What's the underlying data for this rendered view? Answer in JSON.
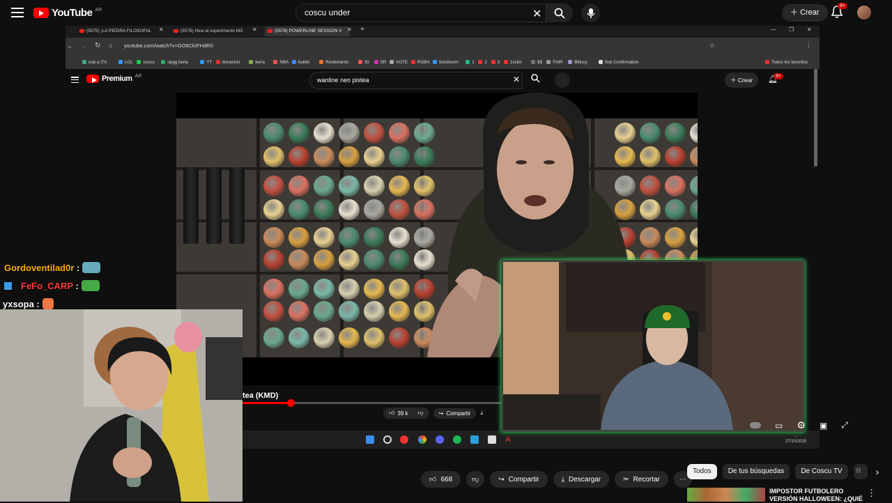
{
  "outer": {
    "logo": "YouTube",
    "country": "AR",
    "search_value": "coscu under",
    "create_label": "Crear",
    "notif_badge": "9+"
  },
  "browser": {
    "tabs": [
      {
        "label": "(5575) ¡LA PIEDRA FILOSOFAL"
      },
      {
        "label": "(5578) Hice el experimento MÁ"
      },
      {
        "label": "(5578) POWERLINE SESSION V"
      }
    ],
    "url": "youtube.com/watch?v=GO6CkIFHdR0",
    "bookmarks": [
      "esp a ITA",
      "LOL",
      "coscu",
      "opgg keria",
      "YT",
      "donacion",
      "keria",
      "NBA",
      "builds",
      "Roobetardo",
      "IG",
      "SR",
      "VOTE",
      "ROBA",
      "Soloboom",
      "1",
      "2",
      "3",
      "1xslot",
      "$$",
      "FAIR",
      "Bitlucy",
      "Sub Confirmation",
      "Todos los favoritos"
    ]
  },
  "inner": {
    "logo": "Premium",
    "country": "AR",
    "search_value": "wanline neo pistea",
    "create_label": "Crear",
    "notif_badge": "9+",
    "video_title": "tea (KMD)",
    "likes": "39 k",
    "share_label": "Compartir",
    "clock_time": "...",
    "clock_date": "27/10/2025"
  },
  "chat": [
    {
      "user": "Gordoventilad0r",
      "color": "#ffb000"
    },
    {
      "user": "FeFo_CARP",
      "color": "#ff3b3b"
    },
    {
      "user": "yxsopa",
      "color": "#ffffff"
    }
  ],
  "bottom": {
    "likes": "668",
    "share_label": "Compartir",
    "download_label": "Descargar",
    "clip_label": "Recortar",
    "chips": [
      "Todos",
      "De tus búsquedas",
      "De Coscu TV",
      "R"
    ],
    "rec_title": "IMPOSTOR FUTBOLERO VERSIÓN HALLOWEEN: ¿QUIÉ"
  }
}
